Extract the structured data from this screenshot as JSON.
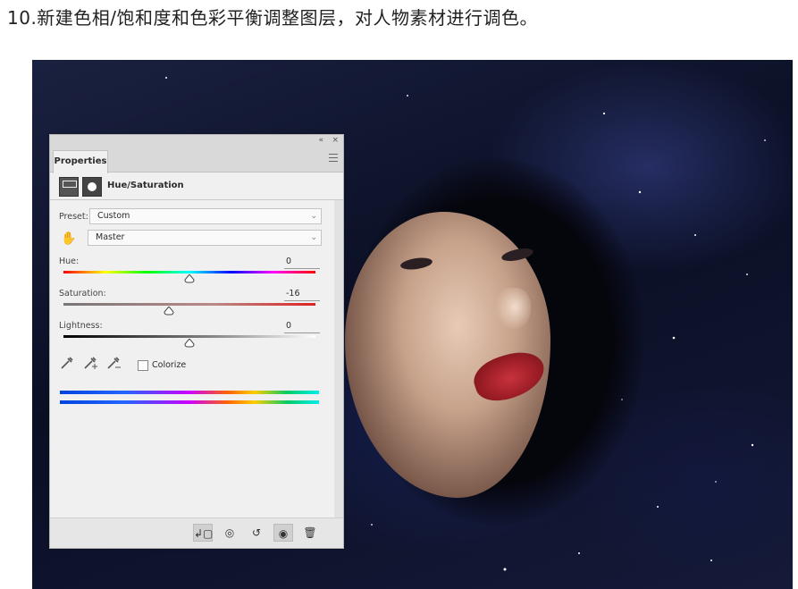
{
  "heading": "10.新建色相/饱和度和色彩平衡调整图层，对人物素材进行调色。",
  "panel": {
    "titlebar": {
      "collapse": "«",
      "close": "×"
    },
    "tab_label": "Properties",
    "type_label": "Hue/Saturation",
    "preset_label": "Preset:",
    "preset_value": "Custom",
    "channel_value": "Master",
    "hue": {
      "label": "Hue:",
      "value": "0",
      "position": 0.5
    },
    "saturation": {
      "label": "Saturation:",
      "value": "-16",
      "position": 0.42
    },
    "lightness": {
      "label": "Lightness:",
      "value": "0",
      "position": 0.5
    },
    "colorize_label": "Colorize",
    "colorize_checked": false
  },
  "icons": {
    "collapse": "double-chevron-icon",
    "close": "close-icon",
    "menu": "menu-icon",
    "adjustment": "adjustment-layer-icon",
    "mask": "layer-mask-icon",
    "hand": "targeted-adjustment-hand-icon",
    "eyedropper": "eyedropper-icon",
    "eyedropper_plus": "eyedropper-plus-icon",
    "eyedropper_minus": "eyedropper-minus-icon",
    "clip": "clip-to-layer-icon",
    "view_previous": "view-previous-icon",
    "reset": "reset-icon",
    "visibility": "eye-icon",
    "delete": "trash-icon"
  },
  "colors": {
    "lips": "#c8323c",
    "panel_bg": "#f0f0f0"
  }
}
